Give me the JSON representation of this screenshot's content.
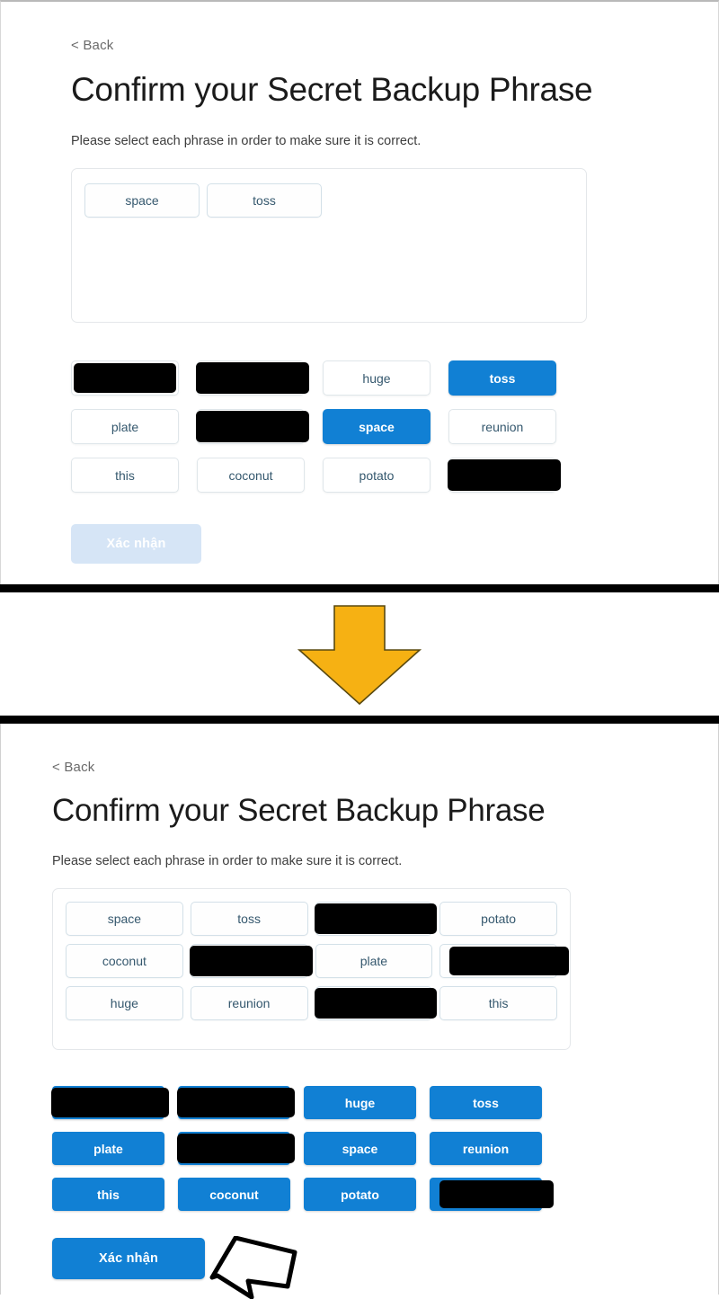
{
  "panels": [
    {
      "id": "before",
      "back_label": "< Back",
      "title": "Confirm your Secret Backup Phrase",
      "subtitle": "Please select each phrase in order to make sure it is correct.",
      "selected_phrases": [
        "space",
        "toss"
      ],
      "word_bank": [
        {
          "label": "",
          "redacted": true,
          "selected": false
        },
        {
          "label": "",
          "redacted": true,
          "selected": false
        },
        {
          "label": "huge",
          "redacted": false,
          "selected": false
        },
        {
          "label": "toss",
          "redacted": false,
          "selected": true
        },
        {
          "label": "plate",
          "redacted": false,
          "selected": false
        },
        {
          "label": "",
          "redacted": true,
          "selected": false
        },
        {
          "label": "space",
          "redacted": false,
          "selected": true
        },
        {
          "label": "reunion",
          "redacted": false,
          "selected": false
        },
        {
          "label": "this",
          "redacted": false,
          "selected": false
        },
        {
          "label": "coconut",
          "redacted": false,
          "selected": false
        },
        {
          "label": "potato",
          "redacted": false,
          "selected": false
        },
        {
          "label": "",
          "redacted": true,
          "selected": false
        }
      ],
      "confirm_label": "Xác nhận",
      "confirm_enabled": false
    },
    {
      "id": "after",
      "back_label": "< Back",
      "title": "Confirm your Secret Backup Phrase",
      "subtitle": "Please select each phrase in order to make sure it is correct.",
      "selected_phrases_grid": [
        {
          "label": "space",
          "redacted": false
        },
        {
          "label": "toss",
          "redacted": false
        },
        {
          "label": "",
          "redacted": true
        },
        {
          "label": "potato",
          "redacted": false
        },
        {
          "label": "coconut",
          "redacted": false
        },
        {
          "label": "",
          "redacted": true
        },
        {
          "label": "plate",
          "redacted": false
        },
        {
          "label": "",
          "redacted": true
        },
        {
          "label": "huge",
          "redacted": false
        },
        {
          "label": "reunion",
          "redacted": false
        },
        {
          "label": "",
          "redacted": true
        },
        {
          "label": "this",
          "redacted": false
        }
      ],
      "word_bank": [
        {
          "label": "",
          "redacted": true,
          "selected": true
        },
        {
          "label": "",
          "redacted": true,
          "selected": true
        },
        {
          "label": "huge",
          "redacted": false,
          "selected": true
        },
        {
          "label": "toss",
          "redacted": false,
          "selected": true
        },
        {
          "label": "plate",
          "redacted": false,
          "selected": true
        },
        {
          "label": "",
          "redacted": true,
          "selected": true
        },
        {
          "label": "space",
          "redacted": false,
          "selected": true
        },
        {
          "label": "reunion",
          "redacted": false,
          "selected": true
        },
        {
          "label": "this",
          "redacted": false,
          "selected": true
        },
        {
          "label": "coconut",
          "redacted": false,
          "selected": true
        },
        {
          "label": "potato",
          "redacted": false,
          "selected": true
        },
        {
          "label": "",
          "redacted": true,
          "selected": true
        }
      ],
      "confirm_label": "Xác nhận",
      "confirm_enabled": true
    }
  ],
  "annotations": {
    "step_arrow_icon": "down-arrow-icon",
    "step_arrow_color": "#F6B113",
    "callout_arrow_icon": "left-arrow-callout-icon"
  },
  "colors": {
    "accent_blue": "#1180d4",
    "disabled_blue": "#cfe1f5",
    "chip_text": "#35586e",
    "chip_border": "#d3e0e8",
    "redaction": "#000000"
  }
}
